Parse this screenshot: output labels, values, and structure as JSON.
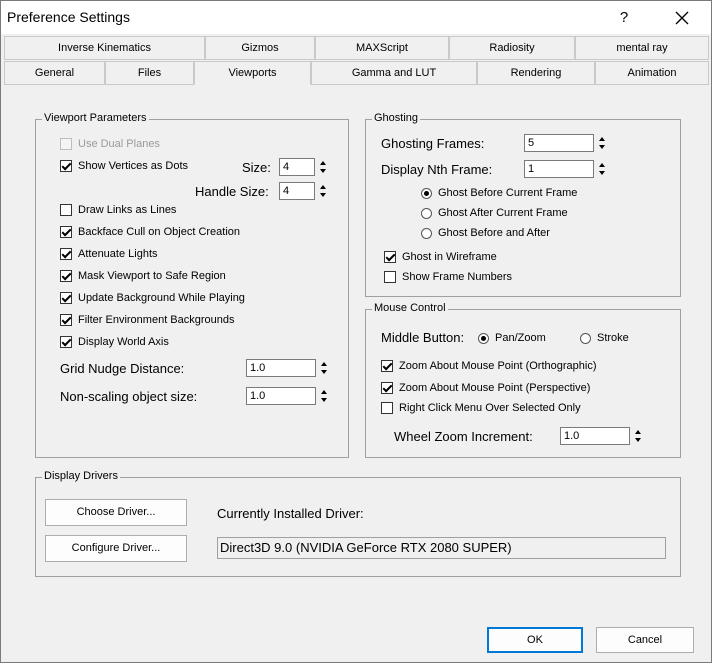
{
  "window": {
    "title": "Preference Settings",
    "help_label": "?",
    "close_label": "close"
  },
  "tabs_row1": [
    "Inverse Kinematics",
    "Gizmos",
    "MAXScript",
    "Radiosity",
    "mental ray"
  ],
  "tabs_row2": [
    "General",
    "Files",
    "Viewports",
    "Gamma and LUT",
    "Rendering",
    "Animation"
  ],
  "active_tab": "Viewports",
  "viewport_params": {
    "label": "Viewport Parameters",
    "use_dual_planes": "Use Dual Planes",
    "show_vertices": "Show Vertices as Dots",
    "size_label": "Size:",
    "size_value": "4",
    "handle_size_label": "Handle Size:",
    "handle_size_value": "4",
    "draw_links": "Draw Links as Lines",
    "backface_cull": "Backface Cull on Object Creation",
    "attenuate_lights": "Attenuate Lights",
    "mask_viewport": "Mask Viewport to Safe Region",
    "update_background": "Update Background While Playing",
    "filter_env": "Filter Environment Backgrounds",
    "display_world_axis": "Display World Axis",
    "grid_nudge_label": "Grid Nudge Distance:",
    "grid_nudge_value": "1.0",
    "non_scaling_label": "Non-scaling object size:",
    "non_scaling_value": "1.0"
  },
  "ghosting": {
    "label": "Ghosting",
    "frames_label": "Ghosting Frames:",
    "frames_value": "5",
    "nth_label": "Display Nth Frame:",
    "nth_value": "1",
    "before": "Ghost Before Current Frame",
    "after": "Ghost After Current Frame",
    "before_after": "Ghost Before and After",
    "wireframe": "Ghost in Wireframe",
    "show_frame_numbers": "Show Frame Numbers"
  },
  "mouse": {
    "label": "Mouse Control",
    "middle_label": "Middle Button:",
    "pan_zoom": "Pan/Zoom",
    "stroke": "Stroke",
    "zoom_ortho": "Zoom About Mouse Point (Orthographic)",
    "zoom_persp": "Zoom About Mouse Point (Perspective)",
    "right_click": "Right Click Menu Over Selected Only",
    "wheel_label": "Wheel Zoom Increment:",
    "wheel_value": "1.0"
  },
  "drivers": {
    "label": "Display Drivers",
    "choose": "Choose Driver...",
    "configure": "Configure Driver...",
    "installed_label": "Currently Installed Driver:",
    "installed_value": "Direct3D 9.0 (NVIDIA GeForce RTX 2080 SUPER)"
  },
  "footer": {
    "ok": "OK",
    "cancel": "Cancel"
  },
  "colors": {
    "accent": "#0078d7"
  }
}
